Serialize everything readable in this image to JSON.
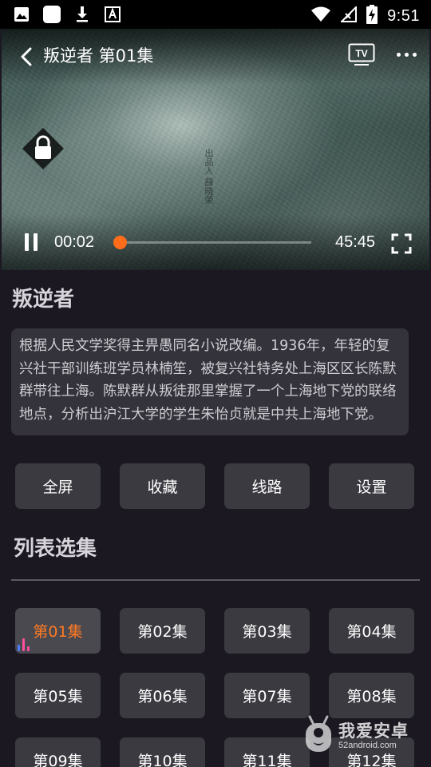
{
  "status_bar": {
    "time": "9:51",
    "left_icons": [
      "image-icon",
      "app-icon",
      "download-icon",
      "font-icon"
    ],
    "right_icons": [
      "wifi-icon",
      "signal-icon",
      "battery-icon"
    ]
  },
  "player": {
    "title": "叛逆者 第01集",
    "overlay_text": "出品人 薛晓荣",
    "current_time": "00:02",
    "duration": "45:45",
    "progress": 0.0007
  },
  "show": {
    "title": "叛逆者",
    "description": "根据人民文学奖得主畀愚同名小说改编。1936年，年轻的复兴社干部训练班学员林楠笙，被复兴社特务处上海区区长陈默群带往上海。陈默群从叛徒那里掌握了一个上海地下党的联络地点，分析出沪江大学的学生朱怡贞就是中共上海地下党。"
  },
  "actions": [
    "全屏",
    "收藏",
    "线路",
    "设置"
  ],
  "episode_section": {
    "title": "列表选集",
    "episodes": [
      "第01集",
      "第02集",
      "第03集",
      "第04集",
      "第05集",
      "第06集",
      "第07集",
      "第08集",
      "第09集",
      "第10集",
      "第11集",
      "第12集"
    ],
    "active_index": 0
  },
  "watermark": {
    "text": "我爱安卓",
    "url": "52android.com"
  },
  "colors": {
    "accent": "#ff6d1a",
    "background": "#1b1822",
    "button": "#3b3a40"
  }
}
